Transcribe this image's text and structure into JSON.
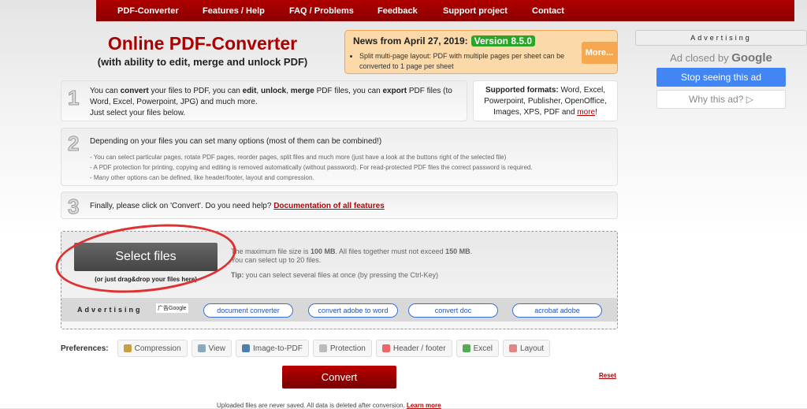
{
  "nav": [
    "PDF-Converter",
    "Features / Help",
    "FAQ / Problems",
    "Feedback",
    "Support project",
    "Contact"
  ],
  "header": {
    "title": "Online PDF-Converter",
    "subtitle": "(with ability to edit, merge and unlock PDF)"
  },
  "news": {
    "heading": "News from April 27, 2019:",
    "version": "Version 8.5.0",
    "item": "Split multi-page layout: PDF with multiple pages per sheet can be converted to 1 page per sheet",
    "more": "More..."
  },
  "step1": {
    "num": "1",
    "s": [
      "You can ",
      "convert",
      " your files to PDF, you can ",
      "edit",
      ", ",
      "unlock",
      ", ",
      "merge",
      " PDF files, you can ",
      "export",
      " PDF files (to Word, Excel, Powerpoint, JPG) and much more."
    ],
    "line2": "Just select your files below."
  },
  "formats": {
    "label": "Supported formats:",
    "text": " Word, Excel, Powerpoint, Publisher, OpenOffice, Images, XPS, PDF and ",
    "more": "more",
    "end": "!"
  },
  "step2": {
    "num": "2",
    "heading": "Depending on your files you can set many options (most of them can be combined!)",
    "lines": [
      "- You can select particular pages, rotate PDF pages, reorder pages, split files and much more (just have a look at the buttons right of the selected file)",
      "- A PDF protection for printing, copying and editing is removed automatically (without password). For read-protected PDF files the correct password is required.",
      "- Many other options can be defined, like header/footer, layout and compression."
    ]
  },
  "step3": {
    "num": "3",
    "text": "Finally, please click on 'Convert'. Do you need help? ",
    "link": "Documentation of all features"
  },
  "upload": {
    "select": "Select files",
    "drag": "(or just drag&drop your files here)",
    "max_a": "The maximum file size is ",
    "max_b": "100 MB",
    ".": ". All files together must not exceed ",
    "max_c": "150 MB",
    "max_d": ".",
    "count": "You can select up to 20 files.",
    "tip_label": "Tip:",
    "tip": " you can select several files at once (by pressing the Ctrl-Key)"
  },
  "ads": {
    "label": "Advertising",
    "google": "广告Google",
    "links": [
      "document converter",
      "convert adobe to word",
      "convert doc",
      "acrobat adobe"
    ]
  },
  "preferences": {
    "label": "Preferences:",
    "items": [
      "Compression",
      "View",
      "Image-to-PDF",
      "Protection",
      "Header / footer",
      "Excel",
      "Layout"
    ]
  },
  "convert": "Convert",
  "reset": "Reset",
  "footer": {
    "text": "Uploaded files are never saved. All data is deleted after conversion. ",
    "link": "Learn more"
  },
  "sidebar": {
    "label": "Advertising",
    "closed": "Ad closed by ",
    "google": "Google",
    "stop": "Stop seeing this ad",
    "why": "Why this ad? ▷"
  }
}
